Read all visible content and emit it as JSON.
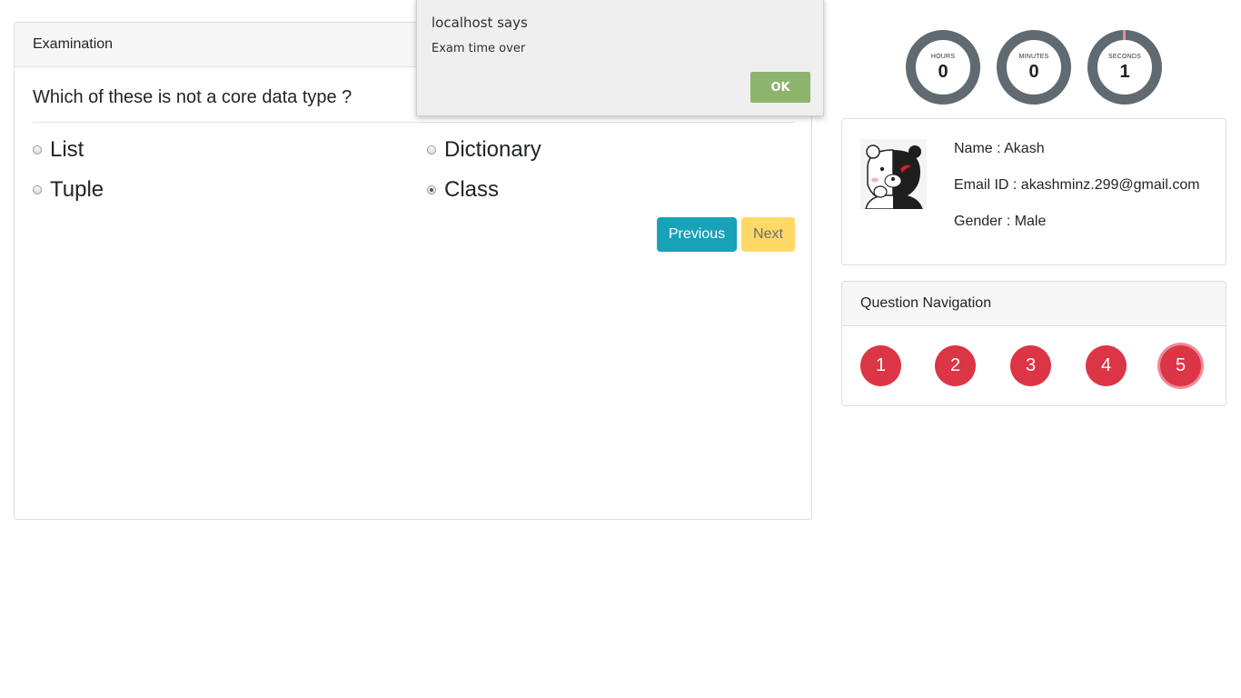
{
  "exam": {
    "header": "Examination",
    "question": "Which of these is not a core data type ?",
    "options": [
      {
        "label": "List",
        "selected": false
      },
      {
        "label": "Dictionary",
        "selected": false
      },
      {
        "label": "Tuple",
        "selected": false
      },
      {
        "label": "Class",
        "selected": true
      }
    ],
    "previous_label": "Previous",
    "next_label": "Next"
  },
  "alert": {
    "title": "localhost says",
    "message": "Exam time over",
    "ok_label": "OK"
  },
  "timer": {
    "hours_label": "HOURS",
    "hours": "0",
    "minutes_label": "MINUTES",
    "minutes": "0",
    "seconds_label": "SECONDS",
    "seconds": "1"
  },
  "profile": {
    "name": "Name : Akash",
    "email": "Email ID : akashminz.299@gmail.com",
    "gender": "Gender : Male"
  },
  "navigation": {
    "header": "Question Navigation",
    "questions": [
      "1",
      "2",
      "3",
      "4",
      "5"
    ],
    "active": "5"
  },
  "colors": {
    "previous": "#17a2b8",
    "next": "#ffd966",
    "question_bubble": "#dc3545",
    "timer_ring": "#606a70",
    "alert_ok": "#8db46c"
  }
}
